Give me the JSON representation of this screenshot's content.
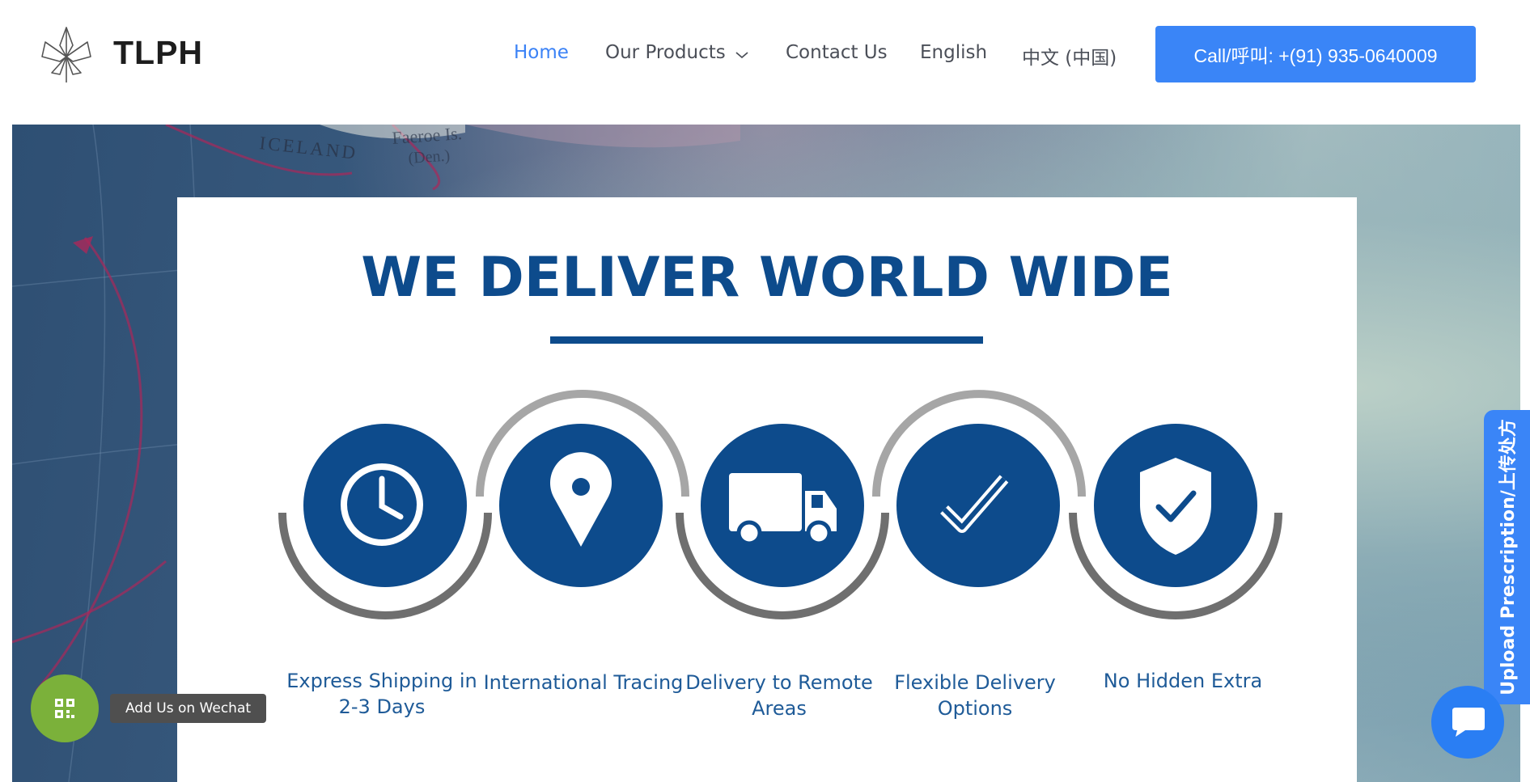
{
  "header": {
    "brand": "TLPH",
    "nav": [
      {
        "label": "Home",
        "active": true
      },
      {
        "label": "Our Products",
        "dropdown": true
      },
      {
        "label": "Contact Us"
      },
      {
        "label": "English"
      },
      {
        "label": "中文 (中国)"
      }
    ],
    "call_button": "Call/呼叫: +(91) 935-0640009"
  },
  "hero": {
    "map_labels": [
      "ICELAND",
      "Faeroe Is.",
      "(Den.)"
    ],
    "card": {
      "title": "WE DELIVER WORLD WIDE",
      "features": [
        {
          "icon": "clock-icon",
          "line1": "Express Shipping in",
          "line2": "2-3 Days"
        },
        {
          "icon": "location-pin-icon",
          "line1": "International Tracing",
          "line2": ""
        },
        {
          "icon": "truck-icon",
          "line1": "Delivery to Remote",
          "line2": "Areas"
        },
        {
          "icon": "checkmark-icon",
          "line1": "Flexible Delivery",
          "line2": "Options"
        },
        {
          "icon": "shield-check-icon",
          "line1": "No Hidden Extra",
          "line2": ""
        }
      ]
    }
  },
  "upload_tab": {
    "label": "Upload Prescription/上传处方"
  },
  "wechat": {
    "label": "Add Us on Wechat"
  },
  "colors": {
    "accent": "#3a85f7",
    "brand_blue": "#0d4b8c",
    "wechat_green": "#7bb13a"
  }
}
